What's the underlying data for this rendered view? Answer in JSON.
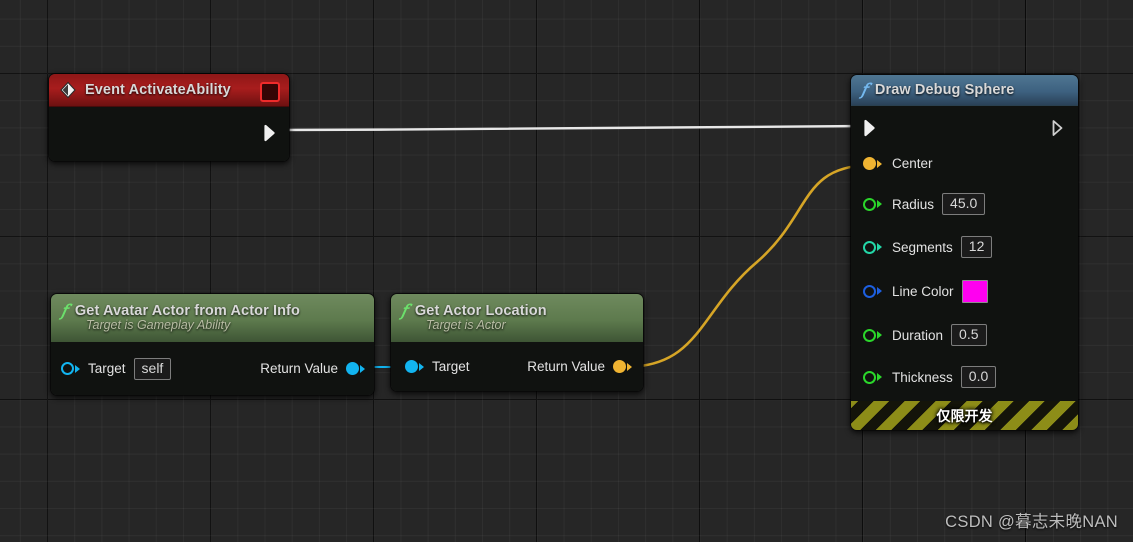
{
  "editor": {
    "name": "unreal-blueprint-graph",
    "background_color": "#262626",
    "grid_minor_color": "#2e2e2e",
    "grid_major_color": "#101010"
  },
  "watermark": {
    "text": "CSDN @暮志未晚NAN"
  },
  "nodes": {
    "event_activate_ability": {
      "title": "Event ActivateAbility",
      "icon": "event-diamond-icon",
      "delegate_icon": "delegate-pin-icon",
      "header_color": "#a81d1d",
      "exec_out": {
        "label": "",
        "icon": "exec-out-pin-icon",
        "connected": true
      }
    },
    "get_avatar_actor": {
      "title": "Get Avatar Actor from Actor Info",
      "subtitle": "Target is Gameplay Ability",
      "icon": "function-fx-icon",
      "header_color": "#5d7a4d",
      "input": {
        "label": "Target",
        "value": "self",
        "pin_color": "#12b4f0",
        "pin_icon": "object-pin-icon"
      },
      "output": {
        "label": "Return Value",
        "pin_color": "#12b4f0",
        "pin_icon": "object-pin-icon"
      }
    },
    "get_actor_location": {
      "title": "Get Actor Location",
      "subtitle": "Target is Actor",
      "icon": "function-fx-icon",
      "header_color": "#5d7a4d",
      "input": {
        "label": "Target",
        "pin_color": "#12b4f0",
        "pin_icon": "object-pin-icon"
      },
      "output": {
        "label": "Return Value",
        "pin_color": "#f0b432",
        "pin_icon": "vector-pin-icon"
      }
    },
    "draw_debug_sphere": {
      "title": "Draw Debug Sphere",
      "icon": "function-fx-icon",
      "header_color": "#3d6180",
      "exec_in": {
        "icon": "exec-in-pin-icon",
        "connected": true
      },
      "exec_out": {
        "icon": "exec-out-pin-icon",
        "connected": false
      },
      "pins": [
        {
          "label": "Center",
          "value": null,
          "kind": "none",
          "pin_color": "#f0b432",
          "connected": true,
          "pin_icon": "vector-pin-icon"
        },
        {
          "label": "Radius",
          "value": "45.0",
          "kind": "text",
          "pin_color": "#2bd62b",
          "connected": false,
          "pin_icon": "float-pin-icon"
        },
        {
          "label": "Segments",
          "value": "12",
          "kind": "text",
          "pin_color": "#23d6a7",
          "connected": false,
          "pin_icon": "int-pin-icon"
        },
        {
          "label": "Line Color",
          "value": "#FF00F0",
          "kind": "color",
          "pin_color": "#1d5fe0",
          "connected": false,
          "pin_icon": "linearcolor-pin-icon"
        },
        {
          "label": "Duration",
          "value": "0.5",
          "kind": "text",
          "pin_color": "#2bd62b",
          "connected": false,
          "pin_icon": "float-pin-icon"
        },
        {
          "label": "Thickness",
          "value": "0.0",
          "kind": "text",
          "pin_color": "#2bd62b",
          "connected": false,
          "pin_icon": "float-pin-icon"
        }
      ],
      "footer": {
        "label": "仅限开发",
        "style": "development-only-hazard-banner"
      }
    }
  },
  "wires": [
    {
      "name": "exec-wire-event-to-draw-debug-sphere",
      "color": "#e8e8e8",
      "from": "event_activate_ability.exec_out",
      "to": "draw_debug_sphere.exec_in"
    },
    {
      "name": "data-wire-avatar-to-actor-location",
      "color": "#12b4f0",
      "from": "get_avatar_actor.output",
      "to": "get_actor_location.input"
    },
    {
      "name": "data-wire-location-to-center",
      "color": "#d6a526",
      "from": "get_actor_location.output",
      "to": "draw_debug_sphere.pins.0"
    }
  ]
}
